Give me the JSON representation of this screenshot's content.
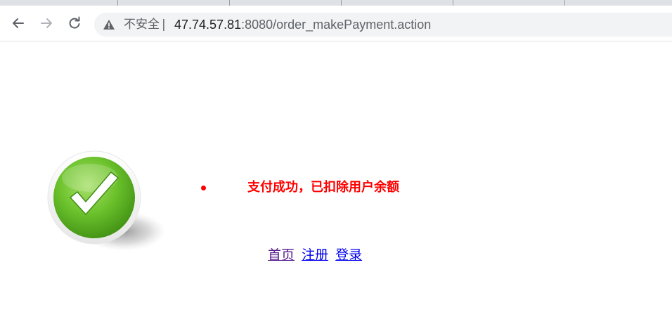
{
  "browser": {
    "security_label": "不安全",
    "separator": "|",
    "url_host": "47.74.57.81",
    "url_rest": ":8080/order_makePayment.action"
  },
  "page": {
    "message": "支付成功，已扣除用户余额",
    "message_color": "#ff0000",
    "links": [
      {
        "label": "首页",
        "state": "visited"
      },
      {
        "label": "注册",
        "state": "link"
      },
      {
        "label": "登录",
        "state": "link"
      }
    ],
    "icon": "checkmark-success-icon"
  }
}
